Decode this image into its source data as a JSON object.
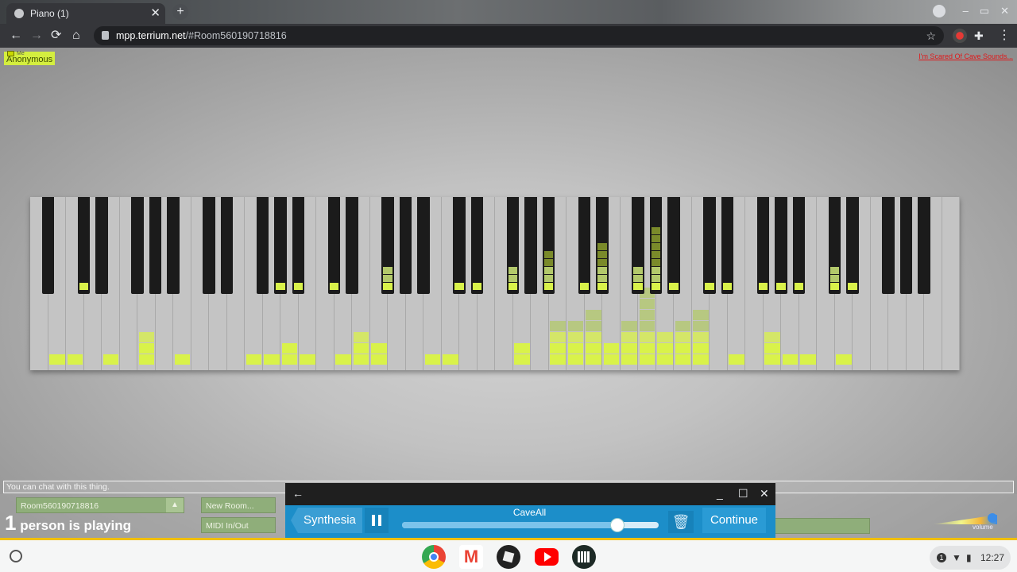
{
  "browser": {
    "tab_title": "Piano (1)",
    "tab_close": "✕",
    "new_tab": "+",
    "url_domain": "mpp.terrium.net",
    "url_path": "/#Room560190718816",
    "nav": {
      "back": "←",
      "forward": "→",
      "reload": "⟳",
      "home": "⌂",
      "star": "☆",
      "menu": "⋮"
    }
  },
  "page": {
    "name_tag": "Anonymous",
    "me_label": "Me",
    "top_right_link": "I'm Scared Of Cave Sounds...",
    "chat_placeholder": "You can chat with this thing.",
    "room_name": "Room560190718816",
    "room_arrow": "▲",
    "people_count": "1",
    "people_text": "person is playing",
    "new_room_button": "New Room...",
    "midi_button": "MIDI In/Out",
    "volume_label": "volume",
    "volume_level": 0.95
  },
  "piano": {
    "white_key_count": 52,
    "white_blocks": [
      {
        "key": 1,
        "count": 1
      },
      {
        "key": 2,
        "count": 1
      },
      {
        "key": 4,
        "count": 1
      },
      {
        "key": 6,
        "count": 3
      },
      {
        "key": 8,
        "count": 1
      },
      {
        "key": 12,
        "count": 1
      },
      {
        "key": 13,
        "count": 1
      },
      {
        "key": 14,
        "count": 2
      },
      {
        "key": 15,
        "count": 1
      },
      {
        "key": 17,
        "count": 1
      },
      {
        "key": 18,
        "count": 3
      },
      {
        "key": 19,
        "count": 2
      },
      {
        "key": 22,
        "count": 1
      },
      {
        "key": 23,
        "count": 1
      },
      {
        "key": 27,
        "count": 2
      },
      {
        "key": 29,
        "count": 4
      },
      {
        "key": 30,
        "count": 4
      },
      {
        "key": 31,
        "count": 5
      },
      {
        "key": 32,
        "count": 2
      },
      {
        "key": 33,
        "count": 4
      },
      {
        "key": 34,
        "count": 7
      },
      {
        "key": 35,
        "count": 3
      },
      {
        "key": 36,
        "count": 4
      },
      {
        "key": 37,
        "count": 5
      },
      {
        "key": 39,
        "count": 1
      },
      {
        "key": 41,
        "count": 3
      },
      {
        "key": 42,
        "count": 1
      },
      {
        "key": 43,
        "count": 1
      },
      {
        "key": 45,
        "count": 1
      }
    ],
    "black_keys": [
      {
        "after": 0,
        "count": 0
      },
      {
        "after": 2,
        "count": 1
      },
      {
        "after": 3,
        "count": 0
      },
      {
        "after": 5,
        "count": 0
      },
      {
        "after": 6,
        "count": 0
      },
      {
        "after": 7,
        "count": 0
      },
      {
        "after": 9,
        "count": 0
      },
      {
        "after": 10,
        "count": 0
      },
      {
        "after": 12,
        "count": 0
      },
      {
        "after": 13,
        "count": 1
      },
      {
        "after": 14,
        "count": 1
      },
      {
        "after": 16,
        "count": 1
      },
      {
        "after": 17,
        "count": 0
      },
      {
        "after": 19,
        "count": 3
      },
      {
        "after": 20,
        "count": 0
      },
      {
        "after": 21,
        "count": 0
      },
      {
        "after": 23,
        "count": 1
      },
      {
        "after": 24,
        "count": 1
      },
      {
        "after": 26,
        "count": 3
      },
      {
        "after": 27,
        "count": 0
      },
      {
        "after": 28,
        "count": 5
      },
      {
        "after": 30,
        "count": 1
      },
      {
        "after": 31,
        "count": 6
      },
      {
        "after": 33,
        "count": 3
      },
      {
        "after": 34,
        "count": 8
      },
      {
        "after": 35,
        "count": 1
      },
      {
        "after": 37,
        "count": 1
      },
      {
        "after": 38,
        "count": 1
      },
      {
        "after": 40,
        "count": 1
      },
      {
        "after": 41,
        "count": 1
      },
      {
        "after": 42,
        "count": 1
      },
      {
        "after": 44,
        "count": 3
      },
      {
        "after": 45,
        "count": 1
      },
      {
        "after": 47,
        "count": 0
      },
      {
        "after": 48,
        "count": 0
      },
      {
        "after": 49,
        "count": 0
      }
    ]
  },
  "synthesia": {
    "back": "←",
    "minimize": "_",
    "maximize": "☐",
    "close": "✕",
    "tab_label": "Synthesia",
    "song": "CaveAll",
    "progress": 0.84,
    "trash": "🗑",
    "continue": "Continue"
  },
  "shelf": {
    "time": "12:27",
    "notification": "1",
    "wifi": "▼",
    "battery": "▮"
  },
  "colors": {
    "note_lit": "#d9f24a",
    "note_dim": "#b3c96b",
    "note_dark": "#7a8a2a",
    "page_bg": "#c2c2c2",
    "accent_green": "#8fae7a",
    "synth_blue": "#1c8ec9"
  }
}
